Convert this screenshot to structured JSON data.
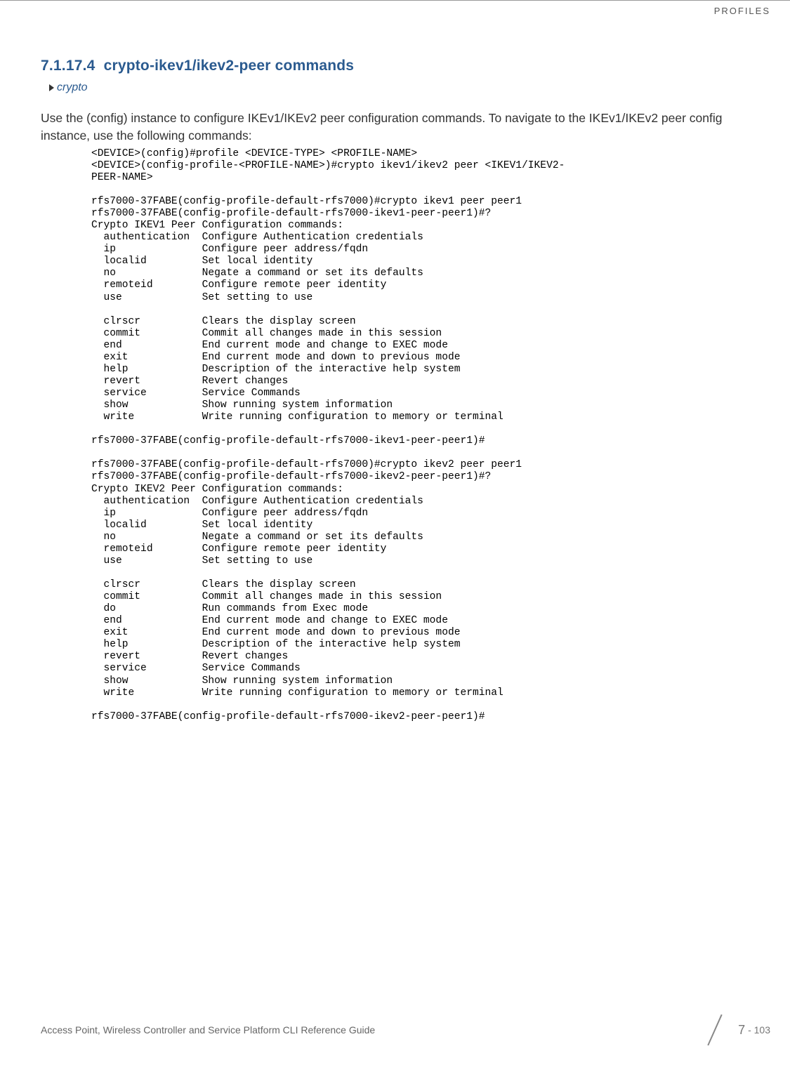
{
  "header": {
    "label": "PROFILES"
  },
  "section": {
    "number": "7.1.17.4",
    "title": "crypto-ikev1/ikev2-peer commands"
  },
  "subsection_link": "crypto",
  "intro": "Use the (config) instance to configure IKEv1/IKEv2 peer configuration commands. To navigate to the IKEv1/IKEv2 peer config instance, use the following commands:",
  "code": "<DEVICE>(config)#profile <DEVICE-TYPE> <PROFILE-NAME>\n<DEVICE>(config-profile-<PROFILE-NAME>)#crypto ikev1/ikev2 peer <IKEV1/IKEV2-\nPEER-NAME>\n\nrfs7000-37FABE(config-profile-default-rfs7000)#crypto ikev1 peer peer1\nrfs7000-37FABE(config-profile-default-rfs7000-ikev1-peer-peer1)#?\nCrypto IKEV1 Peer Configuration commands:\n  authentication  Configure Authentication credentials\n  ip              Configure peer address/fqdn\n  localid         Set local identity\n  no              Negate a command or set its defaults\n  remoteid        Configure remote peer identity\n  use             Set setting to use\n\n  clrscr          Clears the display screen\n  commit          Commit all changes made in this session\n  end             End current mode and change to EXEC mode\n  exit            End current mode and down to previous mode\n  help            Description of the interactive help system\n  revert          Revert changes\n  service         Service Commands\n  show            Show running system information\n  write           Write running configuration to memory or terminal\n\nrfs7000-37FABE(config-profile-default-rfs7000-ikev1-peer-peer1)#\n\nrfs7000-37FABE(config-profile-default-rfs7000)#crypto ikev2 peer peer1\nrfs7000-37FABE(config-profile-default-rfs7000-ikev2-peer-peer1)#?\nCrypto IKEV2 Peer Configuration commands:\n  authentication  Configure Authentication credentials\n  ip              Configure peer address/fqdn\n  localid         Set local identity\n  no              Negate a command or set its defaults\n  remoteid        Configure remote peer identity\n  use             Set setting to use\n\n  clrscr          Clears the display screen\n  commit          Commit all changes made in this session\n  do              Run commands from Exec mode\n  end             End current mode and change to EXEC mode\n  exit            End current mode and down to previous mode\n  help            Description of the interactive help system\n  revert          Revert changes\n  service         Service Commands\n  show            Show running system information\n  write           Write running configuration to memory or terminal\n\nrfs7000-37FABE(config-profile-default-rfs7000-ikev2-peer-peer1)#",
  "footer": {
    "text": "Access Point, Wireless Controller and Service Platform CLI Reference Guide",
    "page_major": "7",
    "page_minor": "- 103"
  }
}
